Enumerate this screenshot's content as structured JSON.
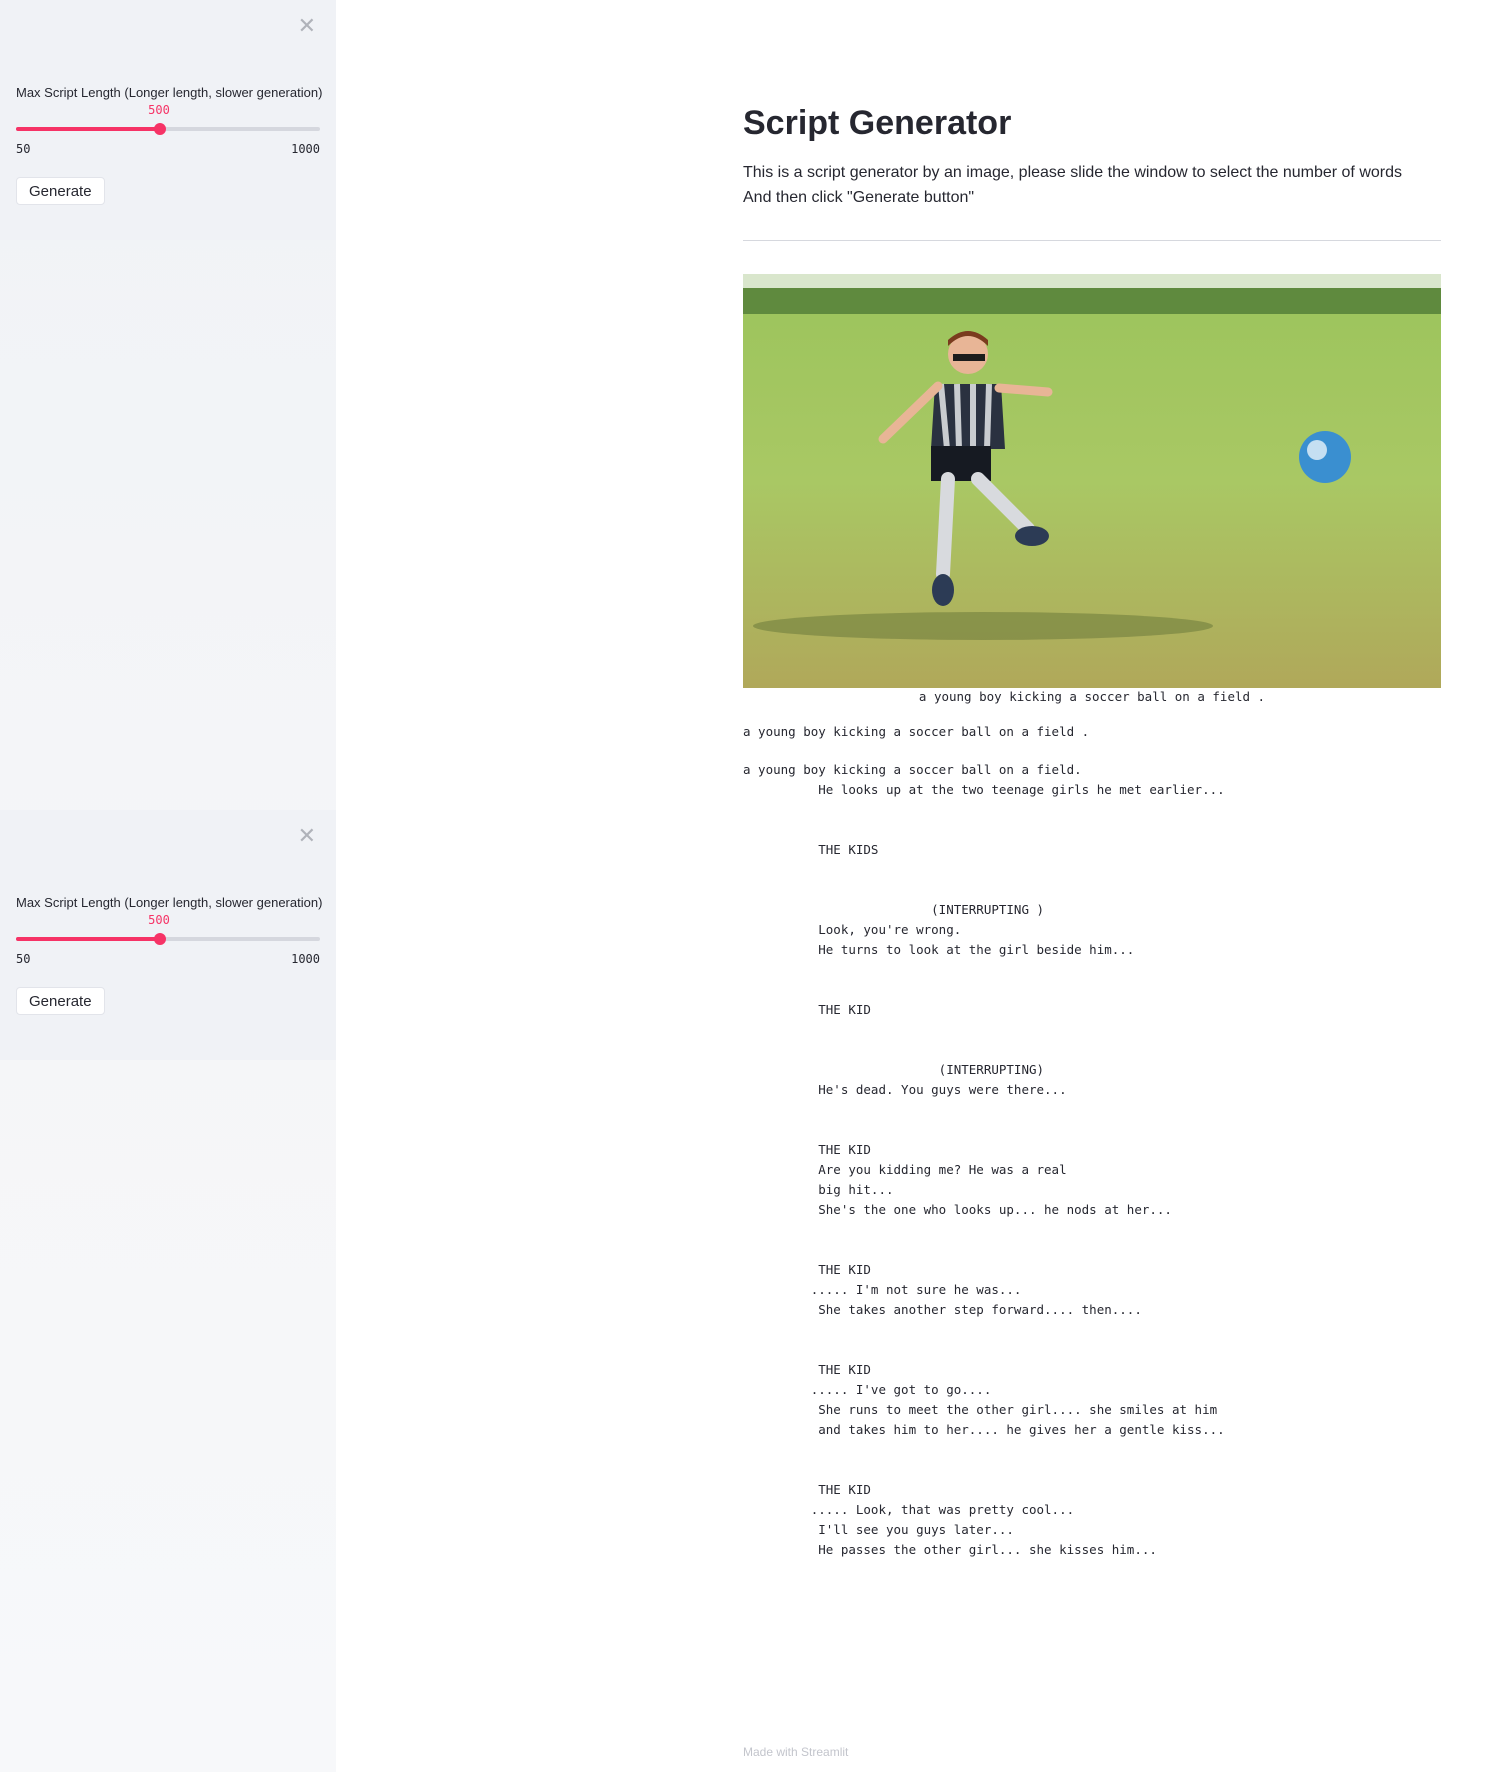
{
  "sidebar": {
    "close_icon": "close-x-icon",
    "slider": {
      "label": "Max Script Length (Longer length, slower generation)",
      "value": "500",
      "min": "50",
      "max": "1000",
      "fraction": 0.474,
      "accent_color": "#f63366"
    },
    "generate_label": "Generate"
  },
  "main": {
    "title": "Script Generator",
    "description_line1": "This is a script generator by an image, please slide the window to select the number of words",
    "description_line2": "And then click \"Generate button\"",
    "image_caption": "a young boy kicking a soccer ball on a field .",
    "caption_repeat": "a young boy kicking a soccer ball on a field .",
    "script_text": "a young boy kicking a soccer ball on a field.\n          He looks up at the two teenage girls he met earlier...\n\n\n          THE KIDS\n\n\n                         (INTERRUPTING )\n          Look, you're wrong.\n          He turns to look at the girl beside him...\n\n\n          THE KID\n\n\n                          (INTERRUPTING)\n          He's dead. You guys were there...\n\n\n          THE KID\n          Are you kidding me? He was a real\n          big hit...\n          She's the one who looks up... he nods at her...\n\n\n          THE KID\n         ..... I'm not sure he was...\n          She takes another step forward.... then....\n\n\n          THE KID\n         ..... I've got to go....\n          She runs to meet the other girl.... she smiles at him\n          and takes him to her.... he gives her a gentle kiss...\n\n\n          THE KID\n         ..... Look, that was pretty cool...\n          I'll see you guys later...\n          He passes the other girl... she kisses him..."
  },
  "footer": "Made with Streamlit"
}
